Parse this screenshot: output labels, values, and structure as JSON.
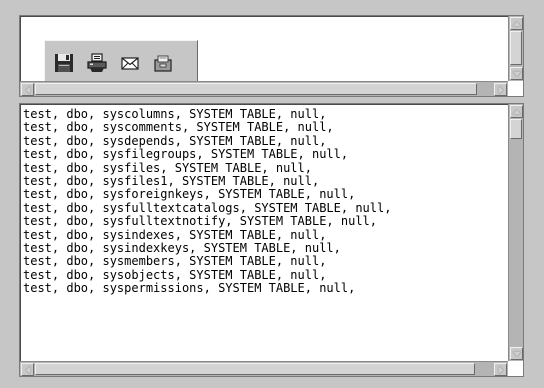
{
  "toolbar": {
    "buttons": [
      {
        "name": "save-button",
        "icon": "floppy-disk-icon"
      },
      {
        "name": "print-button",
        "icon": "printer-icon"
      },
      {
        "name": "email-button",
        "icon": "envelope-icon"
      },
      {
        "name": "export-button",
        "icon": "tray-icon"
      }
    ]
  },
  "results": {
    "rows": [
      "test, dbo, syscolumns, SYSTEM TABLE, null,",
      "test, dbo, syscomments, SYSTEM TABLE, null,",
      "test, dbo, sysdepends, SYSTEM TABLE, null,",
      "test, dbo, sysfilegroups, SYSTEM TABLE, null,",
      "test, dbo, sysfiles, SYSTEM TABLE, null,",
      "test, dbo, sysfiles1, SYSTEM TABLE, null,",
      "test, dbo, sysforeignkeys, SYSTEM TABLE, null,",
      "test, dbo, sysfulltextcatalogs, SYSTEM TABLE, null,",
      "test, dbo, sysfulltextnotify, SYSTEM TABLE, null,",
      "test, dbo, sysindexes, SYSTEM TABLE, null,",
      "test, dbo, sysindexkeys, SYSTEM TABLE, null,",
      "test, dbo, sysmembers, SYSTEM TABLE, null,",
      "test, dbo, sysobjects, SYSTEM TABLE, null,",
      "test, dbo, syspermissions, SYSTEM TABLE, null,"
    ]
  },
  "colors": {
    "window_bg": "#c6c6c6",
    "pane_bg": "#ffffff",
    "scroll_track": "#b4b4b4"
  }
}
